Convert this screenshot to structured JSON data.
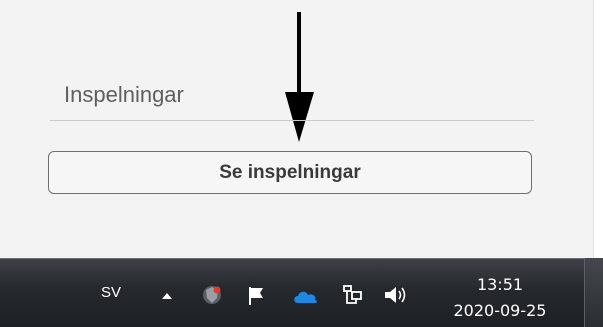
{
  "section": {
    "title": "Inspelningar"
  },
  "button": {
    "label": "Se inspelningar"
  },
  "taskbar": {
    "language": "SV",
    "tray_icons": [
      "chevron-up-icon",
      "security-shield-icon",
      "action-center-flag-icon",
      "onedrive-cloud-icon",
      "network-icon",
      "volume-icon"
    ],
    "clock": {
      "time": "13:51",
      "date": "2020-09-25"
    }
  },
  "annotation": {
    "arrow": "black-arrow-down-icon"
  }
}
